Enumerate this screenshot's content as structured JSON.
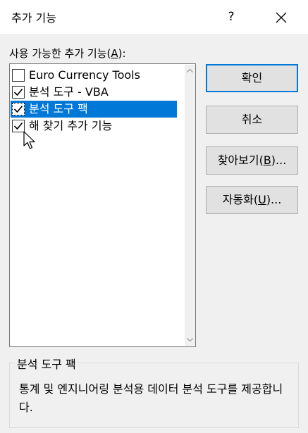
{
  "window": {
    "title": "추가 기능",
    "help_label": "?",
    "close_icon": "close-icon"
  },
  "list": {
    "label": "사용 가능한 추가 기능(",
    "label_accel": "A",
    "label_suffix": "):",
    "items": [
      {
        "label": "Euro Currency Tools",
        "checked": false,
        "selected": false
      },
      {
        "label": "분석 도구 - VBA",
        "checked": true,
        "selected": false
      },
      {
        "label": "분석 도구 팩",
        "checked": true,
        "selected": true
      },
      {
        "label": "해 찾기 추가 기능",
        "checked": true,
        "selected": false
      }
    ]
  },
  "buttons": {
    "ok": "확인",
    "cancel": "취소",
    "browse": "찾아보기(",
    "browse_accel": "B",
    "browse_suffix": ")...",
    "automation": "자동화(",
    "automation_accel": "U",
    "automation_suffix": ")..."
  },
  "description": {
    "title": "분석 도구 팩",
    "text": "통계 및 엔지니어링 분석용 데이터 분석 도구를 제공합니다."
  },
  "colors": {
    "selection": "#0078d7",
    "dialog_bg": "#f0f0f0"
  }
}
